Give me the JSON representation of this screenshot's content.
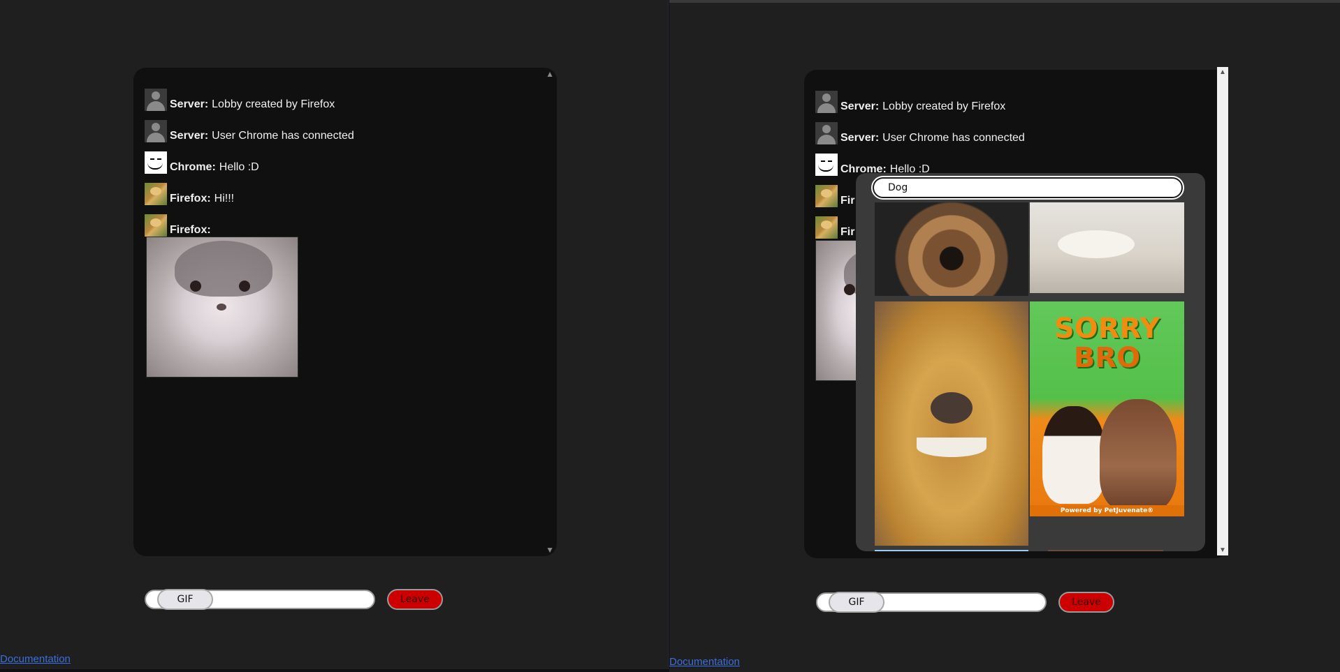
{
  "left_window": {
    "messages": [
      {
        "sender": "Server:",
        "text": "Lobby created by Firefox",
        "avatar": "server-avatar-icon"
      },
      {
        "sender": "Server:",
        "text": "User Chrome has connected",
        "avatar": "server-avatar-icon"
      },
      {
        "sender": "Chrome:",
        "text": "Hello :D",
        "avatar": "smiley-avatar-icon"
      },
      {
        "sender": "Firefox:",
        "text": "Hi!!!",
        "avatar": "burger-avatar-icon"
      },
      {
        "sender": "Firefox:",
        "text": "",
        "avatar": "burger-avatar-icon",
        "attachment": "cat-gif"
      }
    ],
    "input_value": "",
    "gif_button": "GIF",
    "leave_button": "Leave",
    "doc_link": "Documentation"
  },
  "right_window": {
    "messages": [
      {
        "sender": "Server:",
        "text": "Lobby created by Firefox"
      },
      {
        "sender": "Server:",
        "text": "User Chrome has connected"
      },
      {
        "sender": "Chrome:",
        "text": "Hello :D"
      },
      {
        "sender": "Fir",
        "text": ""
      },
      {
        "sender": "Fir",
        "text": ""
      }
    ],
    "gif_search_value": "Dog",
    "gif_results": [
      "dog-fisheye-gif",
      "white-dog-eating-gif",
      "golden-retriever-smiling-gif",
      "sorry-bro-gif"
    ],
    "sorry_line1": "SORRY",
    "sorry_line2": "BRO",
    "powered_by": "Powered by PetJuvenate®",
    "input_value": "",
    "gif_button": "GIF",
    "leave_button": "Leave",
    "doc_link": "Documentation"
  },
  "colors": {
    "page_bg": "#1f1f1f",
    "chat_bg": "#101010",
    "leave_red": "#cc0000",
    "link_blue": "#3a6fe0"
  }
}
